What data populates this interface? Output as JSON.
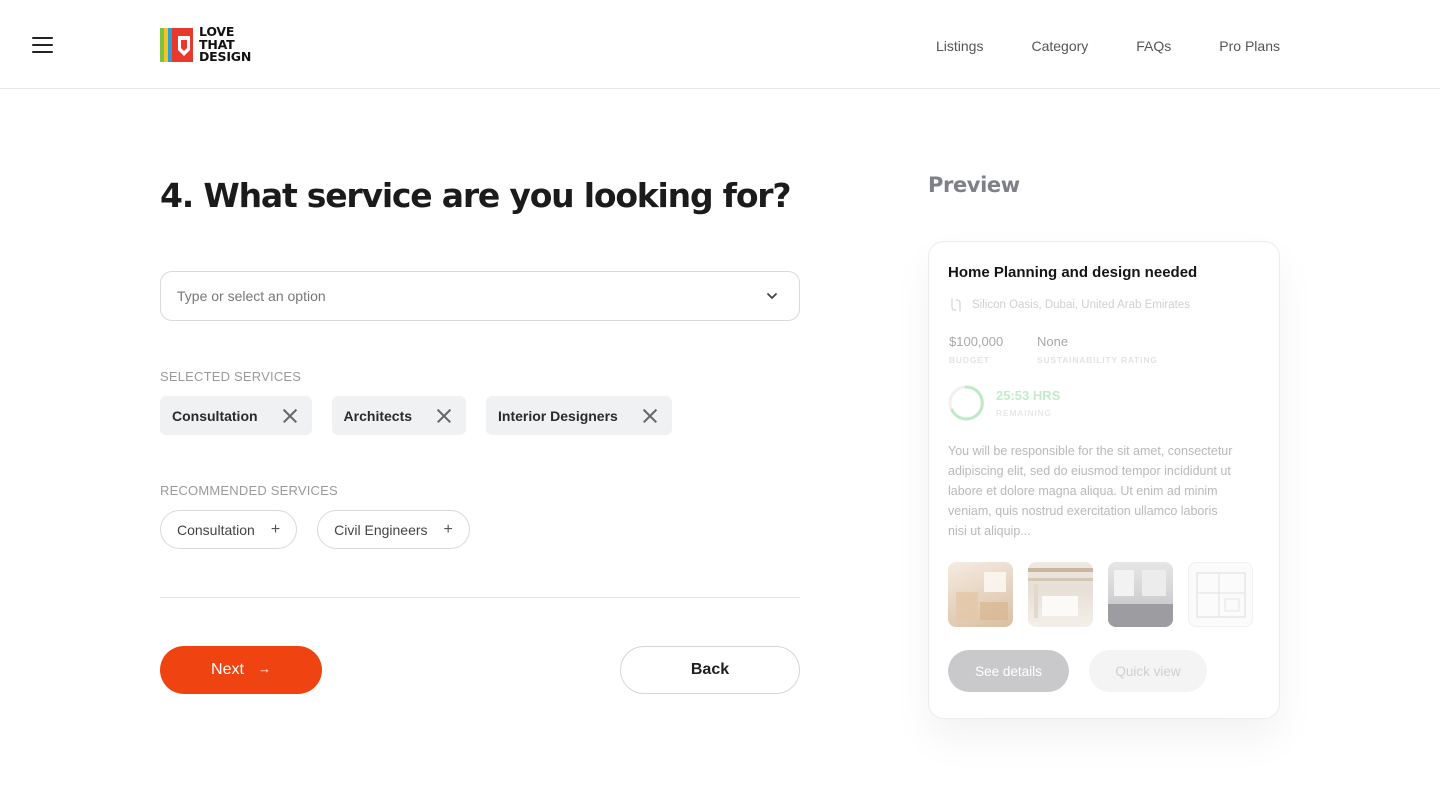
{
  "header": {
    "menu_icon": "hamburger-icon",
    "logo_lines": [
      "LOVE",
      "THAT",
      "DESIGN"
    ],
    "nav": [
      "Listings",
      "Category",
      "FAQs",
      "Pro Plans"
    ]
  },
  "form": {
    "question": "4. What service are you looking for?",
    "select_placeholder": "Type or select an option",
    "selected_label": "SELECTED SERVICES",
    "selected": [
      "Consultation",
      "Architects",
      "Interior Designers"
    ],
    "recommended_label": "RECOMMENDED SERVICES",
    "recommended": [
      "Consultation",
      "Civil Engineers"
    ],
    "next_label": "Next",
    "next_arrow": "→",
    "back_label": "Back"
  },
  "preview": {
    "title": "Preview",
    "card_title": "Home Planning and design needed",
    "location": "Silicon Oasis, Dubai, United Arab Emirates",
    "budget_value": "$100,000",
    "budget_label": "BUDGET",
    "rating_value": "None",
    "rating_label": "SUSTAINABILITY RATING",
    "timer_value": "25:53 HRS",
    "timer_label": "REMAINING",
    "description": "You will be responsible for the sit amet, consectetur adipiscing elit, sed do eiusmod tempor incididunt ut labore et dolore magna aliqua. Ut enim ad minim veniam, quis nostrud exercitation ullamco laboris nisi ut aliquip...",
    "see_details_label": "See details",
    "quick_view_label": "Quick view"
  },
  "colors": {
    "accent": "#f04312",
    "timer_green": "#c2ecc9"
  }
}
